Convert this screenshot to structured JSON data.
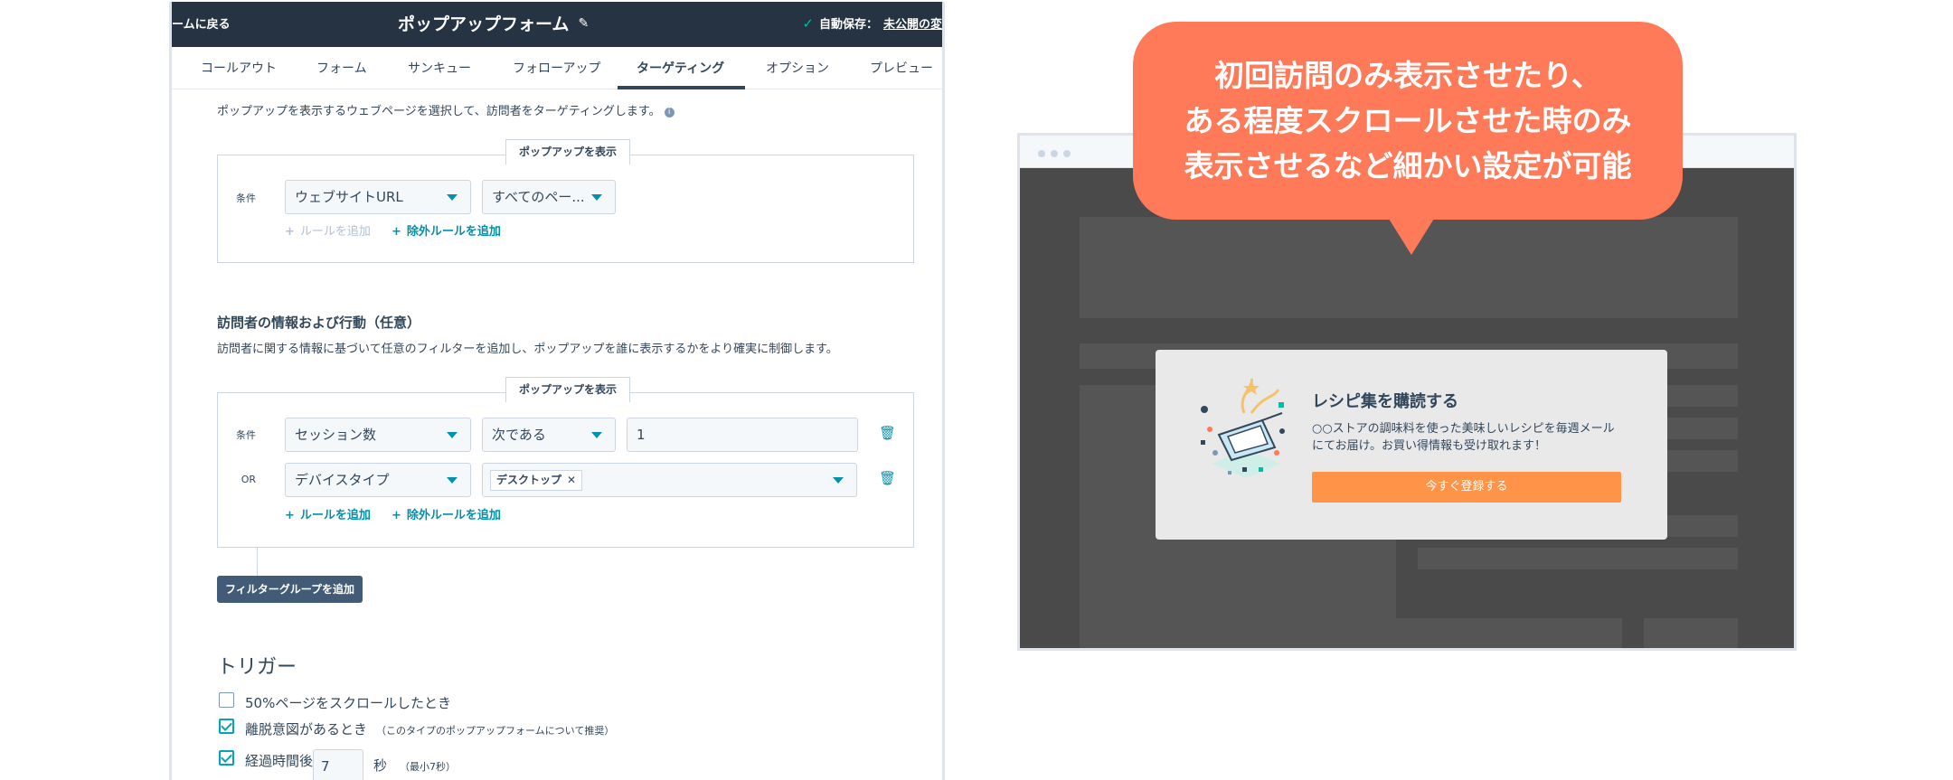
{
  "editor": {
    "back_label": "ームに戻る",
    "title": "ポップアップフォーム",
    "autosave_label": "自動保存：",
    "autosave_status": "未公開の変",
    "tabs": [
      "コールアウト",
      "フォーム",
      "サンキュー",
      "フォローアップ",
      "ターゲティング",
      "オプション",
      "プレビュー"
    ],
    "active_tab": "ターゲティング",
    "targeting": {
      "description": "ポップアップを表示するウェブページを選択して、訪問者をターゲティングします。",
      "box_tag": "ポップアップを表示",
      "condition_label": "条件",
      "field_select": "ウェブサイトURL",
      "operator_select": "すべてのペー...",
      "add_rule": "ルールを追加",
      "add_exclude_rule": "除外ルールを追加"
    },
    "visitor": {
      "title": "訪問者の情報および行動（任意）",
      "description": "訪問者に関する情報に基づいて任意のフィルターを追加し、ポップアップを誰に表示するかをより確実に制御します。",
      "box_tag": "ポップアップを表示",
      "row1_label": "条件",
      "row1_field": "セッション数",
      "row1_operator": "次である",
      "row1_value": "1",
      "row2_label": "OR",
      "row2_field": "デバイスタイプ",
      "row2_chip": "デスクトップ",
      "add_rule": "ルールを追加",
      "add_exclude_rule": "除外ルールを追加",
      "add_filter_group": "フィルターグループを追加"
    },
    "trigger": {
      "title": "トリガー",
      "options": [
        {
          "label": "50%ページをスクロールしたとき",
          "checked": false,
          "note": ""
        },
        {
          "label": "離脱意図があるとき",
          "checked": true,
          "note": "（このタイプのポップアップフォームについて推奨）"
        },
        {
          "label": "経過時間後",
          "checked": true,
          "note": ""
        }
      ],
      "delay_value": "7",
      "delay_unit": "秒",
      "delay_note": "（最小7秒）"
    }
  },
  "callout": {
    "lines": [
      "初回訪問のみ表示させたり、",
      "ある程度スクロールさせた時のみ",
      "表示させるなど細かい設定が可能"
    ]
  },
  "preview": {
    "modal_title": "レシピ集を購読する",
    "modal_body": "○○ストアの調味料を使った美味しいレシピを毎週メールにてお届け。お買い得情報も受け取れます！",
    "modal_cta": "今すぐ登録する"
  },
  "colors": {
    "topbar": "#253342",
    "accent_teal": "#0091ae",
    "callout": "#ff7a59",
    "cta": "#ff9448"
  }
}
